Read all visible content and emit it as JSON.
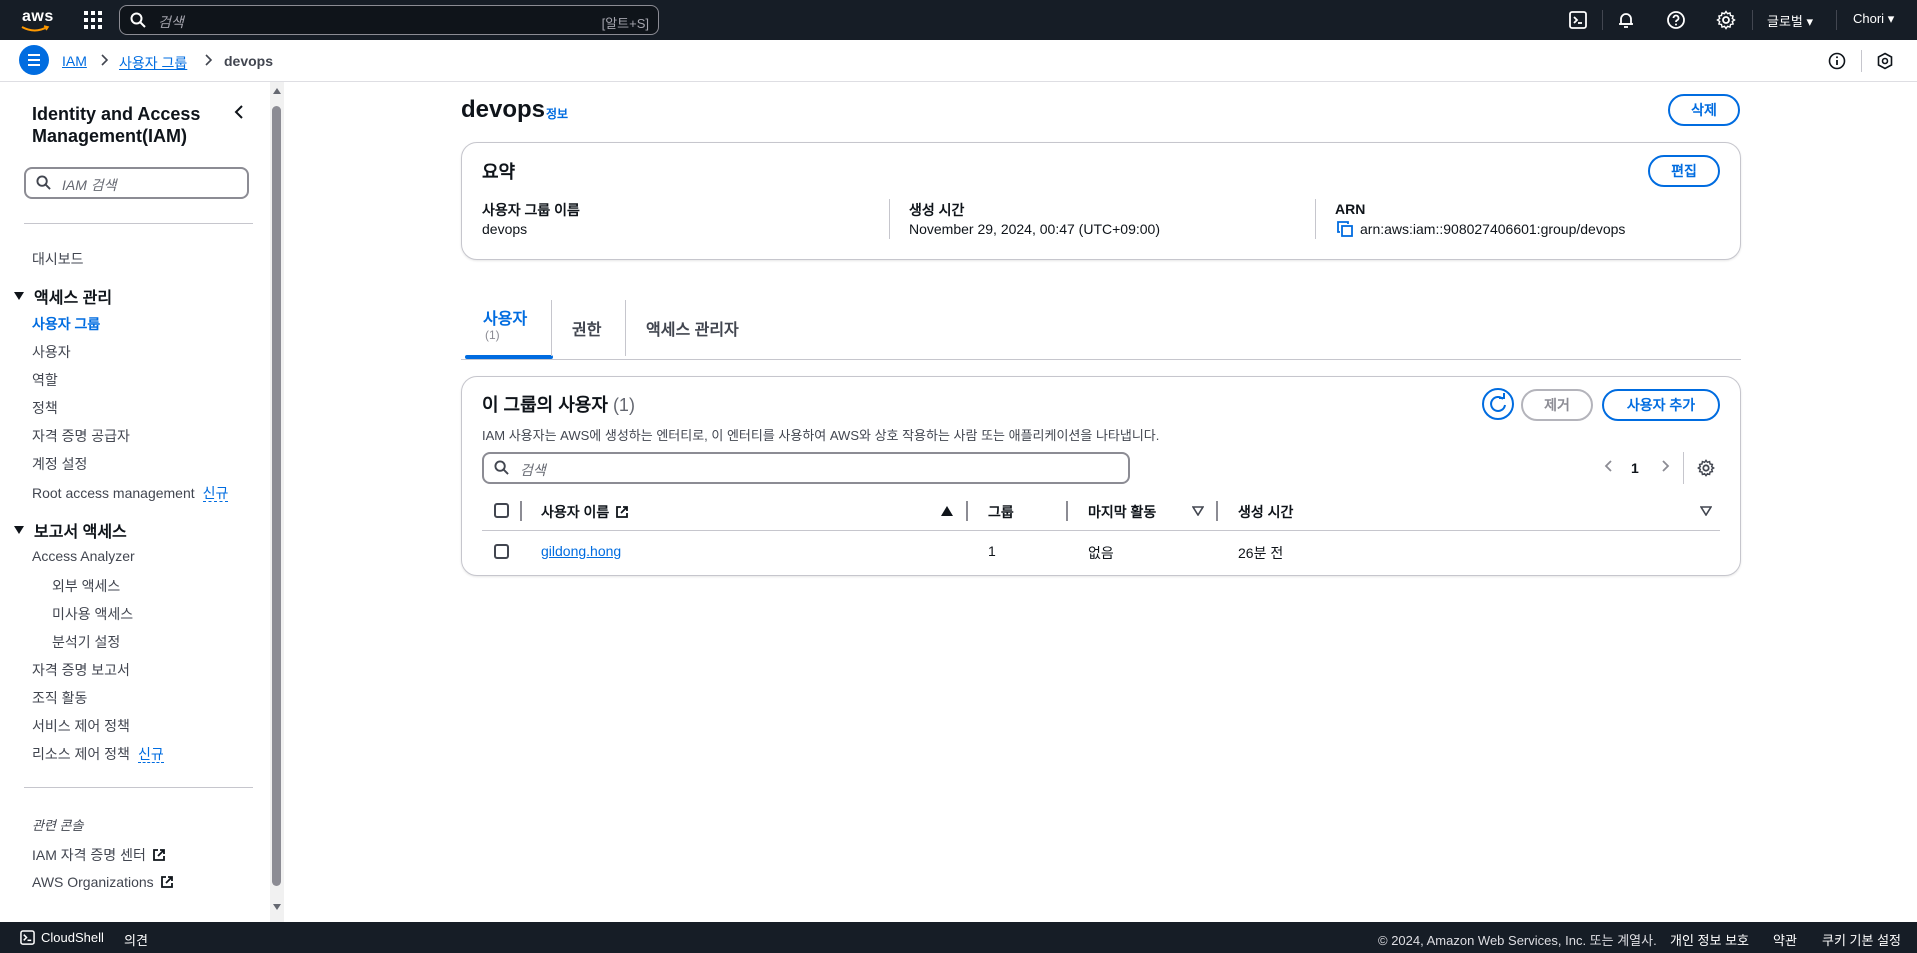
{
  "topnav": {
    "logo_text": "aws",
    "search_placeholder": "검색",
    "search_shortcut": "[알트+S]",
    "region": "글로벌",
    "user": "Chori"
  },
  "breadcrumb": {
    "items": [
      "IAM",
      "사용자 그룹",
      "devops"
    ]
  },
  "sidebar": {
    "title": "Identity and Access Management(IAM)",
    "search_placeholder": "IAM 검색",
    "dashboard": "대시보드",
    "access_mgmt_section": "액세스 관리",
    "access_items": [
      "사용자 그룹",
      "사용자",
      "역할",
      "정책",
      "자격 증명 공급자",
      "계정 설정"
    ],
    "root_access": "Root access management",
    "new_badge": "신규",
    "reports_section": "보고서 액세스",
    "access_analyzer": "Access Analyzer",
    "analyzer_items": [
      "외부 액세스",
      "미사용 액세스",
      "분석기 설정"
    ],
    "report_items": [
      "자격 증명 보고서",
      "조직 활동",
      "서비스 제어 정책"
    ],
    "resource_policy": "리소스 제어 정책",
    "related_consoles": "관련 콘솔",
    "related_items": [
      "IAM 자격 증명 센터",
      "AWS Organizations"
    ]
  },
  "page": {
    "title": "devops",
    "info": "정보",
    "delete_button": "삭제"
  },
  "summary": {
    "title": "요약",
    "edit_button": "편집",
    "group_name_label": "사용자 그룹 이름",
    "group_name_value": "devops",
    "created_label": "생성 시간",
    "created_value": "November 29, 2024, 00:47 (UTC+09:00)",
    "arn_label": "ARN",
    "arn_value": "arn:aws:iam::908027406601:group/devops"
  },
  "tabs": [
    {
      "label": "사용자",
      "count": "(1)"
    },
    {
      "label": "권한"
    },
    {
      "label": "액세스 관리자"
    }
  ],
  "users_panel": {
    "title": "이 그룹의 사용자",
    "count": "(1)",
    "description": "IAM 사용자는 AWS에 생성하는 엔터티로, 이 엔터티를 사용하여 AWS와 상호 작용하는 사람 또는 애플리케이션을 나타냅니다.",
    "remove_button": "제거",
    "add_button": "사용자 추가",
    "search_placeholder": "검색",
    "page": "1",
    "columns": [
      "사용자 이름",
      "그룹",
      "마지막 활동",
      "생성 시간"
    ],
    "rows": [
      {
        "name": "gildong.hong",
        "groups": "1",
        "last_activity": "없음",
        "created": "26분 전"
      }
    ]
  },
  "footer": {
    "cloudshell": "CloudShell",
    "feedback": "의견",
    "copyright": "© 2024, Amazon Web Services, Inc. 또는 계열사.",
    "privacy": "개인 정보 보호",
    "terms": "약관",
    "cookies": "쿠키 기본 설정"
  },
  "colors": {
    "nav_bg": "#161d26",
    "accent": "#006ce0"
  }
}
